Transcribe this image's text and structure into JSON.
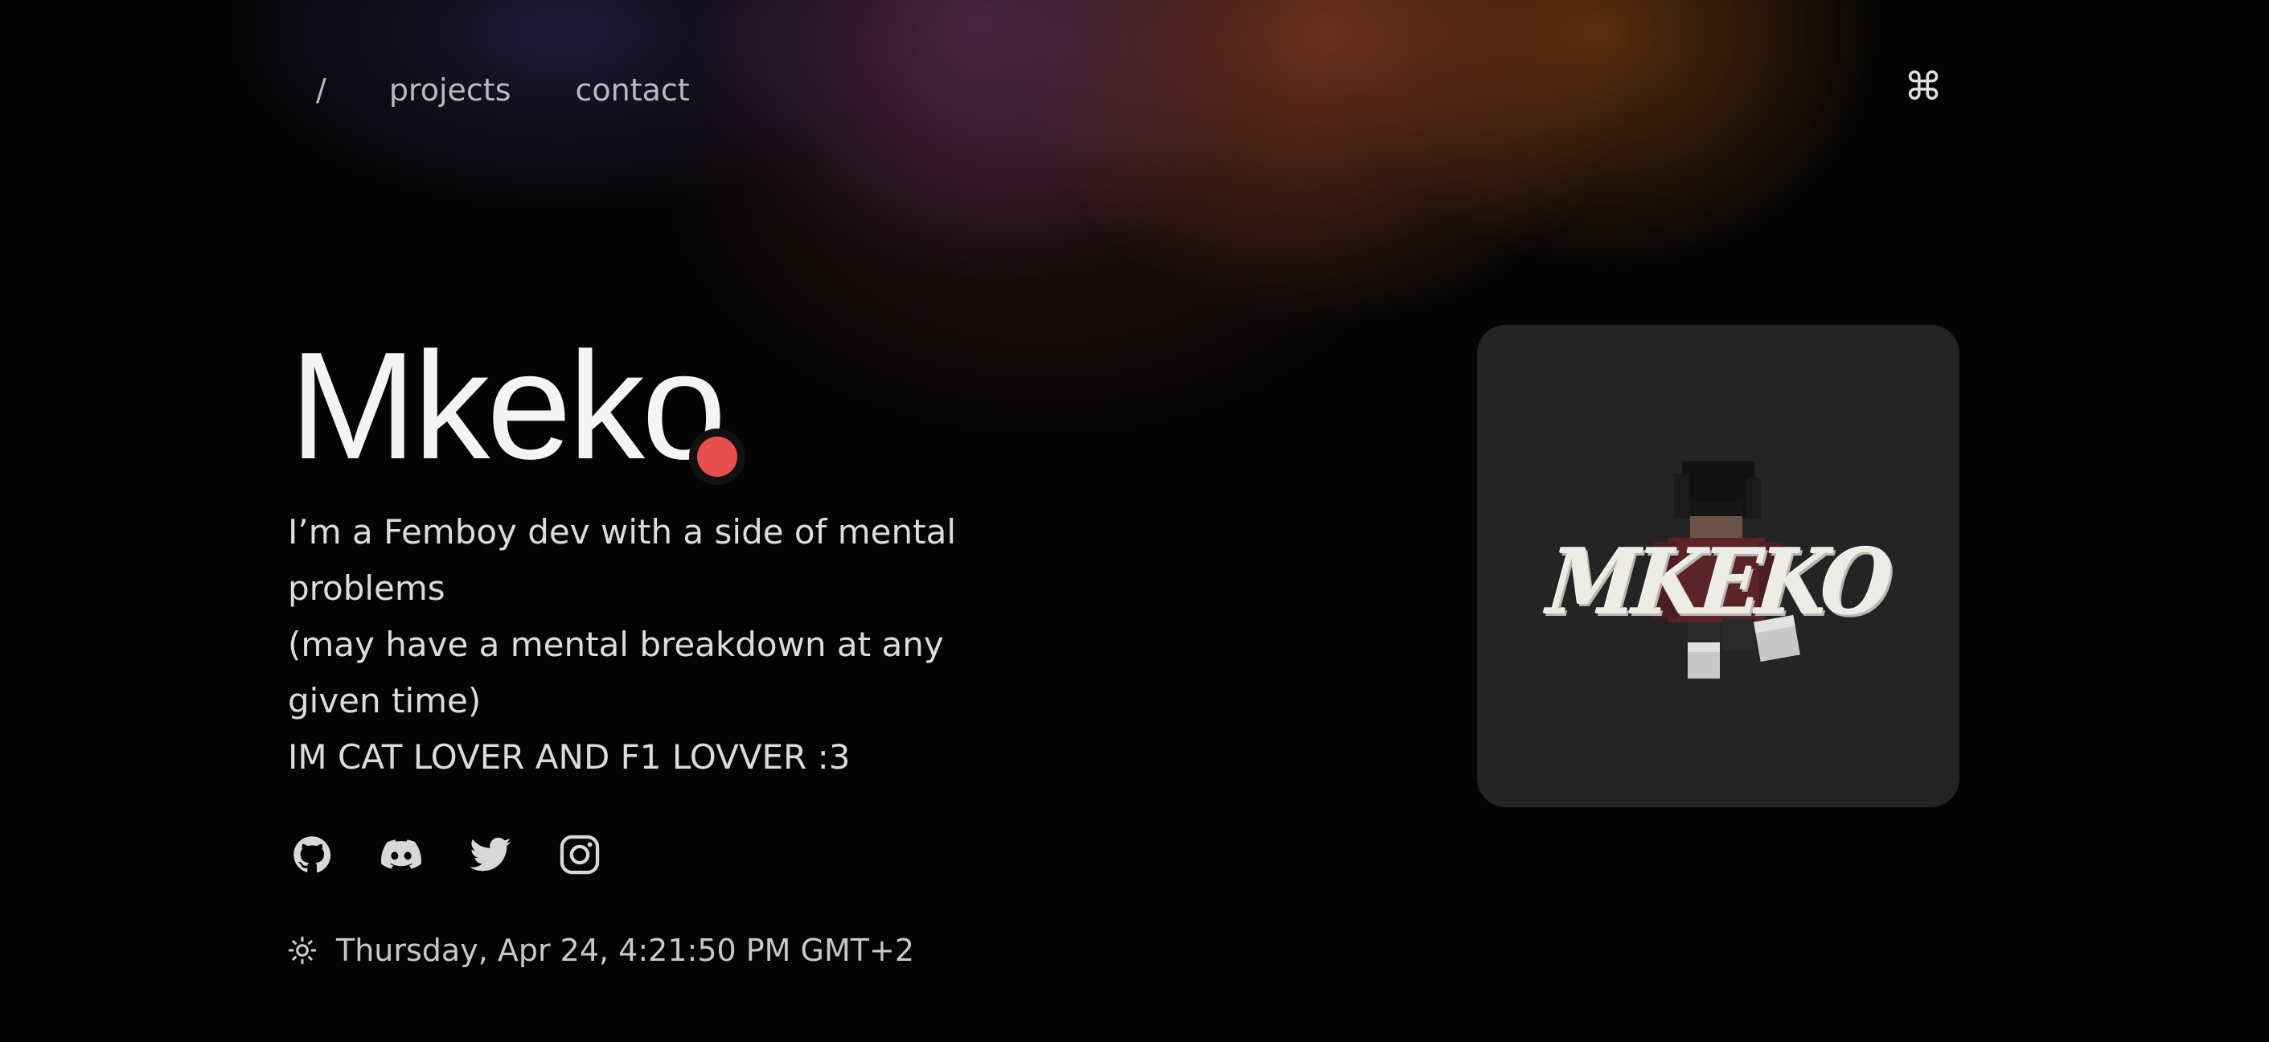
{
  "nav": {
    "home_label": "/",
    "projects_label": "projects",
    "contact_label": "contact",
    "command_icon": "⌘"
  },
  "hero": {
    "title": "Mkeko",
    "accent_color": "#e85050"
  },
  "bio": {
    "line1": "I’m a Femboy dev with a side of mental problems",
    "line2": "(may have a mental breakdown at any given time)",
    "line3": "IM CAT LOVER AND F1 LOVVER :3"
  },
  "socials": [
    {
      "name": "github-icon"
    },
    {
      "name": "discord-icon"
    },
    {
      "name": "twitter-icon"
    },
    {
      "name": "instagram-icon"
    }
  ],
  "clock": {
    "icon": "sun-icon",
    "text": "Thursday, Apr 24, 4:21:50 PM GMT+2"
  },
  "avatar": {
    "logo_text": "MKEKO"
  }
}
